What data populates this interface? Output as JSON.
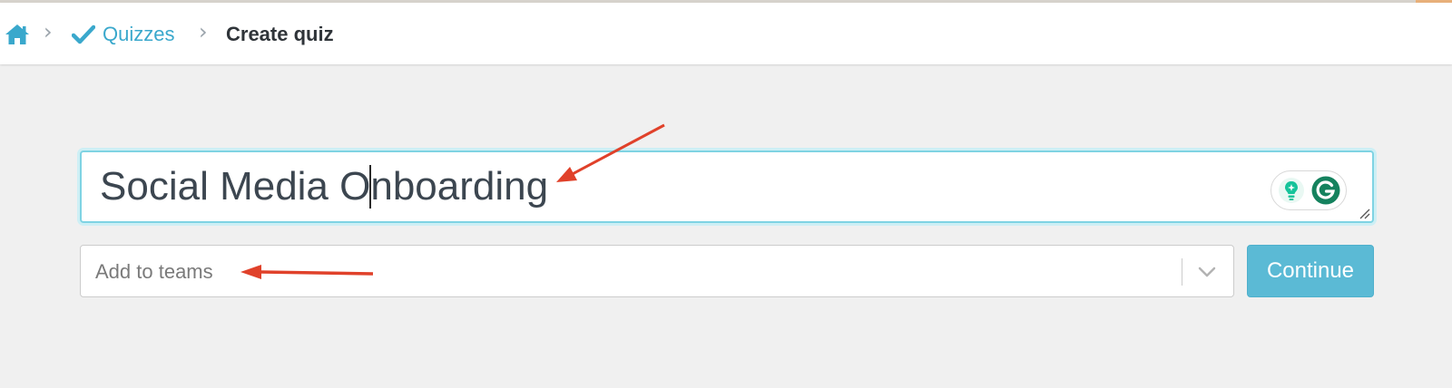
{
  "breadcrumb": {
    "home_icon": "home-icon",
    "separator": "›",
    "quizzes_label": "Quizzes",
    "current_label": "Create quiz"
  },
  "form": {
    "title_before_caret": "Social Media O",
    "title_after_caret": "nboarding",
    "teams_placeholder": "Add to teams",
    "continue_label": "Continue"
  },
  "colors": {
    "accent": "#3aa8cc",
    "button": "#5bbad5",
    "annotation_arrow": "#e0412a",
    "grammarly_green": "#15c39a"
  },
  "icons": [
    "home-icon",
    "check-icon",
    "chevron-down-icon",
    "lightbulb-icon",
    "grammarly-icon",
    "resize-handle-icon"
  ]
}
